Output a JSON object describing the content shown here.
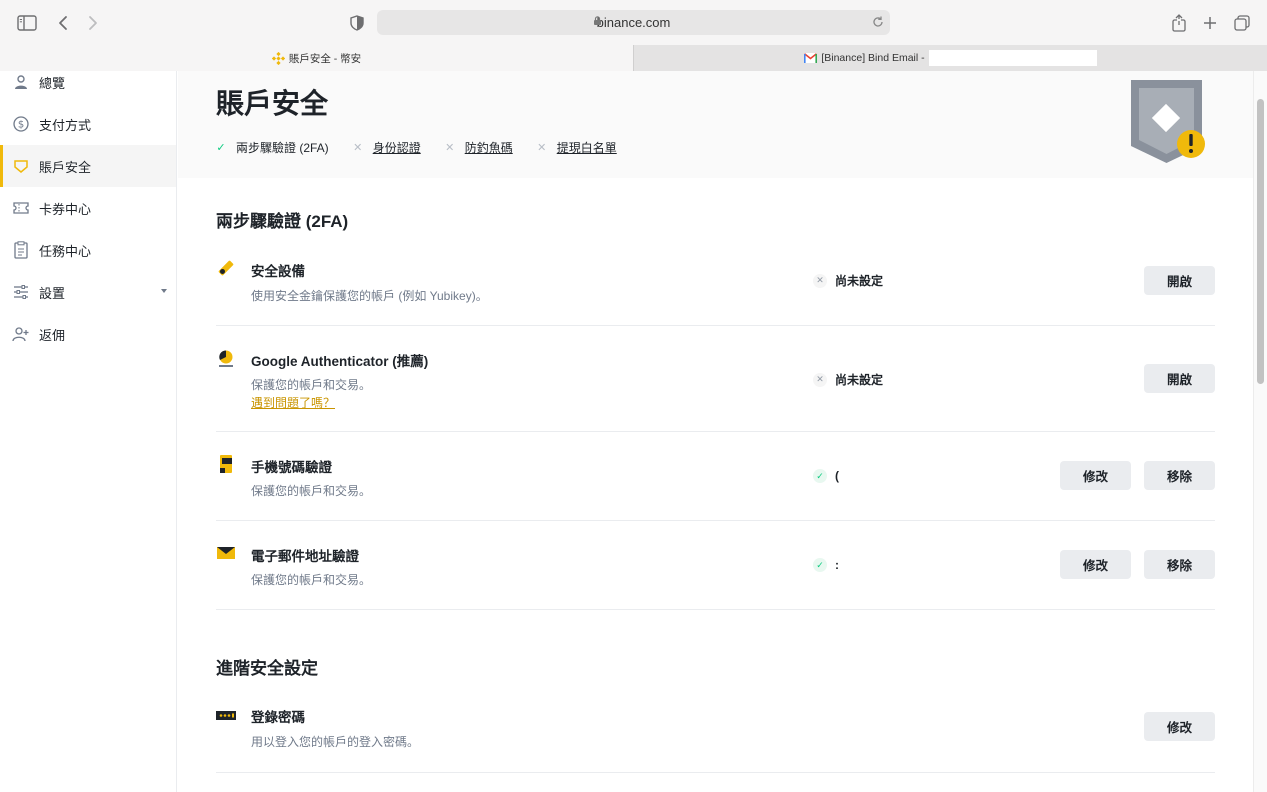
{
  "browser": {
    "url": "binance.com",
    "tabs": [
      {
        "label": "賬戶安全 - 幣安",
        "icon": "binance-icon"
      },
      {
        "label": "[Binance] Bind Email -",
        "icon": "gmail-icon"
      }
    ]
  },
  "sidebar": {
    "items": [
      {
        "label": "總覽",
        "icon": "user-icon"
      },
      {
        "label": "支付方式",
        "icon": "dollar-icon"
      },
      {
        "label": "賬戶安全",
        "icon": "shield-icon",
        "active": true
      },
      {
        "label": "卡券中心",
        "icon": "ticket-icon"
      },
      {
        "label": "任務中心",
        "icon": "clipboard-icon"
      },
      {
        "label": "設置",
        "icon": "sliders-icon"
      },
      {
        "label": "返佣",
        "icon": "add-user-icon"
      }
    ]
  },
  "header": {
    "title": "賬戶安全",
    "status": [
      {
        "label": "兩步驟驗證 (2FA)",
        "done": true
      },
      {
        "label": "身份認證",
        "done": false
      },
      {
        "label": "防釣魚碼",
        "done": false
      },
      {
        "label": "提現白名單",
        "done": false
      }
    ]
  },
  "twofa": {
    "title": "兩步驟驗證 (2FA)",
    "rows": [
      {
        "title": "安全設備",
        "desc": "使用安全金鑰保護您的帳戶 (例如 Yubikey)。",
        "status": "尚未設定",
        "button": "開啟"
      },
      {
        "title": "Google Authenticator (推薦)",
        "desc": "保護您的帳戶和交易。",
        "link": "遇到問題了嗎？",
        "status": "尚未設定",
        "button": "開啟"
      },
      {
        "title": "手機號碼驗證",
        "desc": "保護您的帳戶和交易。",
        "status": "(",
        "edit": "修改",
        "remove": "移除"
      },
      {
        "title": "電子郵件地址驗證",
        "desc": "保護您的帳戶和交易。",
        "status": ":",
        "edit": "修改",
        "remove": "移除"
      }
    ]
  },
  "advanced": {
    "title": "進階安全設定",
    "rows": [
      {
        "title": "登錄密碼",
        "desc": "用以登入您的帳戶的登入密碼。",
        "button": "修改"
      }
    ]
  },
  "colors": {
    "accent": "#F0B90B",
    "success": "#0ECB81",
    "text": "#1E2329",
    "muted": "#707A8A"
  }
}
